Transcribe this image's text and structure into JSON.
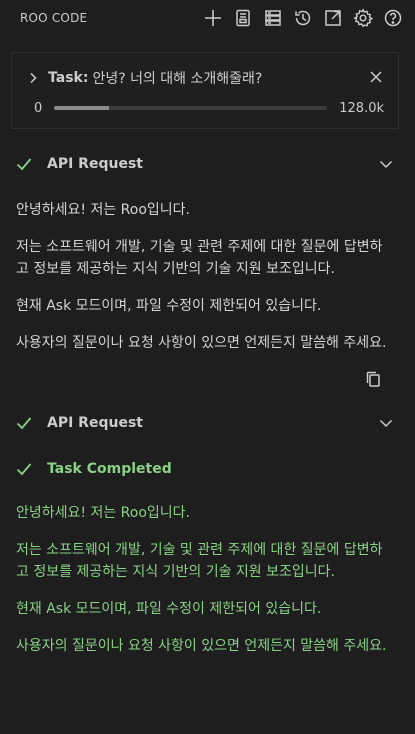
{
  "header": {
    "title": "ROO CODE",
    "icons": [
      "plus-icon",
      "history-notebook-icon",
      "server-stack-icon",
      "history-icon",
      "open-external-icon",
      "gear-icon",
      "help-icon"
    ]
  },
  "task": {
    "label": "Task:",
    "text": "안녕? 너의 대해 소개해줄래?",
    "context_used": "0",
    "context_max": "128.0k",
    "context_fill_fraction": 0.2
  },
  "sections": [
    {
      "label": "API Request",
      "status": "success"
    },
    {
      "label": "API Request",
      "status": "success"
    },
    {
      "label": "Task Completed",
      "status": "completed"
    }
  ],
  "response": {
    "paragraphs": [
      "안녕하세요! 저는 Roo입니다.",
      "저는 소프트웨어 개발, 기술 및 관련 주제에 대한 질문에 답변하고 정보를 제공하는 지식 기반의 기술 지원 보조입니다.",
      "현재 Ask 모드이며, 파일 수정이 제한되어 있습니다.",
      "사용자의 질문이나 요청 사항이 있으면 언제든지 말씀해 주세요."
    ]
  },
  "completion": {
    "paragraphs": [
      "안녕하세요! 저는 Roo입니다.",
      "저는 소프트웨어 개발, 기술 및 관련 주제에 대한 질문에 답변하고 정보를 제공하는 지식 기반의 기술 지원 보조입니다.",
      "현재 Ask 모드이며, 파일 수정이 제한되어 있습니다.",
      "사용자의 질문이나 요청 사항이 있으면 언제든지 말씀해 주세요."
    ]
  },
  "colors": {
    "background": "#1e1e1e",
    "success_green": "#89d185",
    "text": "#cccccc"
  }
}
